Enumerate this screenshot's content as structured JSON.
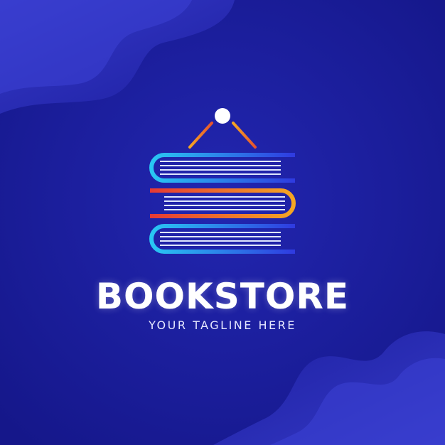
{
  "brand": {
    "name": "BOOKSTORE",
    "tagline": "YOUR TAGLINE HERE"
  },
  "logo": {
    "icon": "stacked-books-icon",
    "colors": {
      "background": "#1d1f9f",
      "blue_light": "#29c7f3",
      "blue_dark": "#2f3ae0",
      "orange": "#f5a623",
      "red": "#e53935",
      "knob": "#ffffff"
    }
  }
}
